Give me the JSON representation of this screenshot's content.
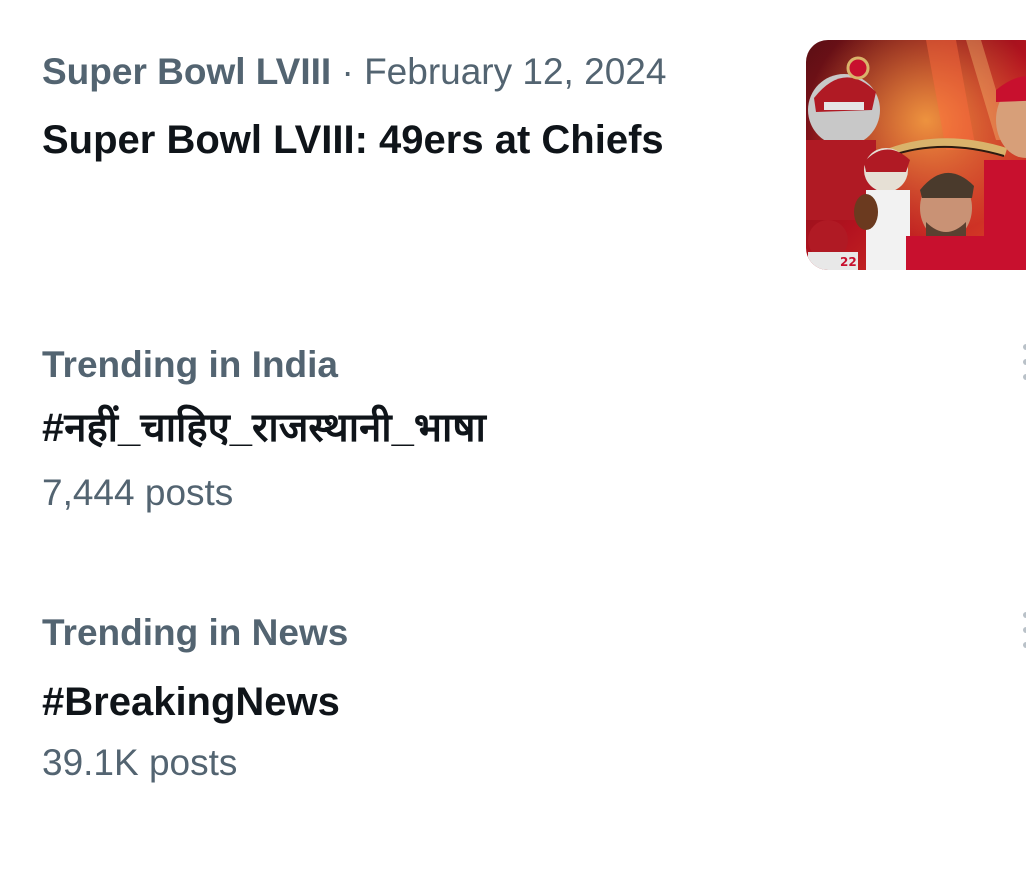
{
  "trends": [
    {
      "source": "Super Bowl LVIII",
      "separator": " · ",
      "date": "February 12, 2024",
      "title": "Super Bowl LVIII: 49ers at Chiefs"
    },
    {
      "context": "Trending in India",
      "title": "#नहीं_चाहिए_राजस्थानी_भाषा",
      "count": "7,444 posts"
    },
    {
      "context": "Trending in News",
      "title": "#BreakingNews",
      "count": "39.1K posts"
    }
  ],
  "colors": {
    "secondary_text": "#536471",
    "primary_text": "#0f1419",
    "accent_red": "#c8102e",
    "accent_gold": "#d9b36b"
  },
  "icons": {
    "more": "more-dots-icon"
  }
}
